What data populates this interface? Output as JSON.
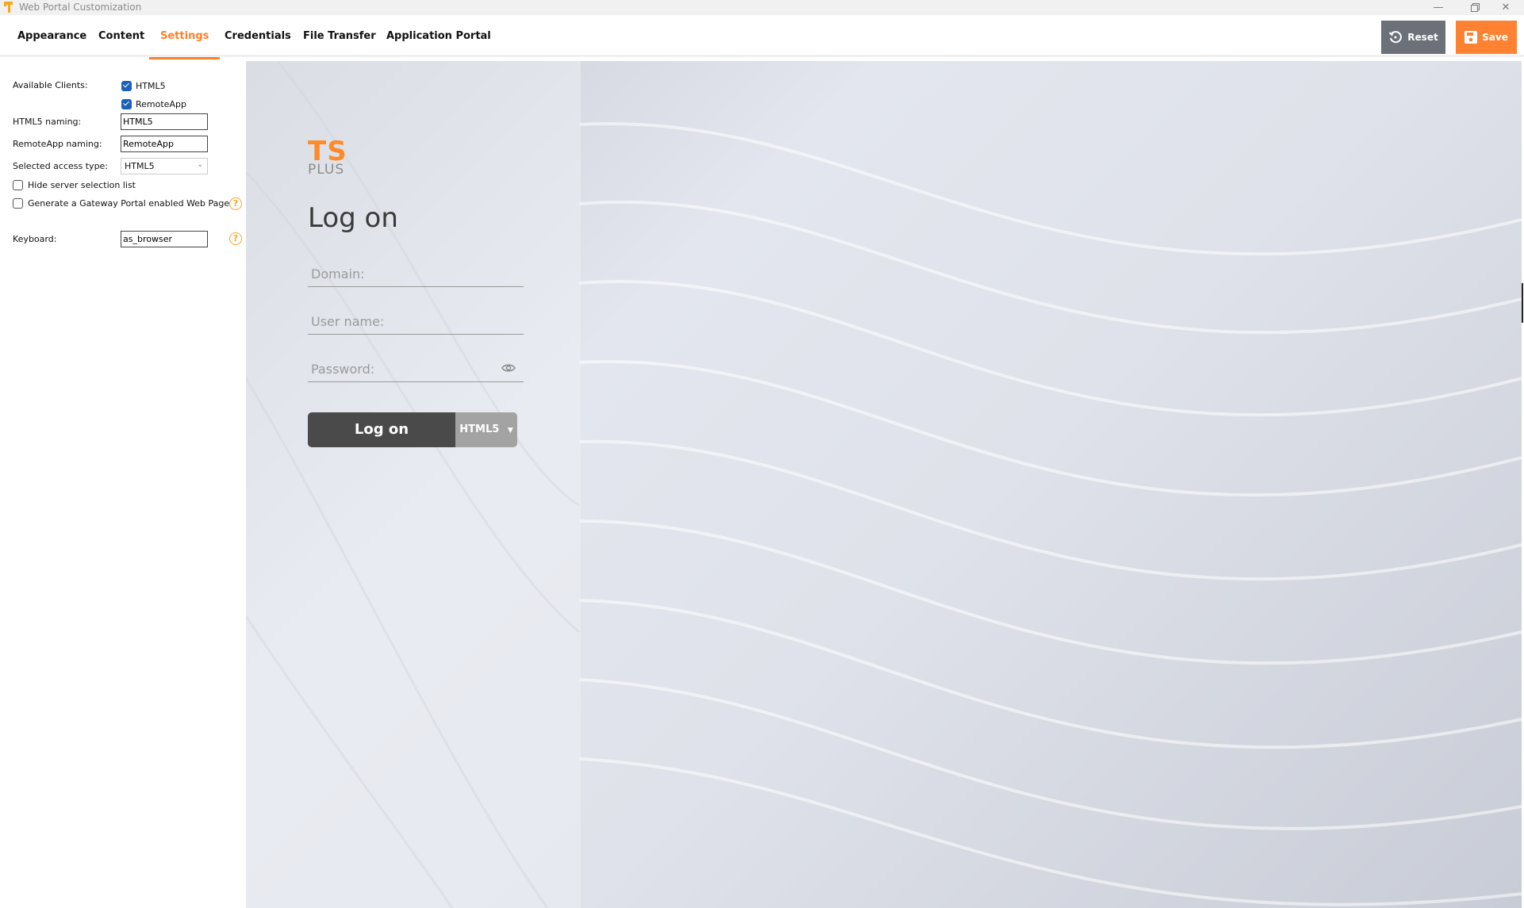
{
  "window": {
    "title": "Web Portal Customization",
    "controls": [
      "minimize",
      "restore",
      "close"
    ]
  },
  "tabs": [
    {
      "label": "Appearance",
      "active": false
    },
    {
      "label": "Content",
      "active": false
    },
    {
      "label": "Settings",
      "active": true
    },
    {
      "label": "Credentials",
      "active": false
    },
    {
      "label": "File Transfer",
      "active": false
    },
    {
      "label": "Application Portal",
      "active": false
    }
  ],
  "toolbar": {
    "reset_label": "Reset",
    "save_label": "Save"
  },
  "colors": {
    "accent": "#ff7f2a",
    "reset_bg": "#6b7079",
    "save_bg": "#ff8233",
    "checkbox": "#1a62b8",
    "help": "#f5a623"
  },
  "settings": {
    "available_clients_label": "Available Clients:",
    "clients": [
      {
        "label": "HTML5",
        "checked": true
      },
      {
        "label": "RemoteApp",
        "checked": true
      }
    ],
    "html5_naming_label": "HTML5 naming:",
    "html5_naming_value": "HTML5",
    "remoteapp_naming_label": "RemoteApp naming:",
    "remoteapp_naming_value": "RemoteApp",
    "access_type_label": "Selected access type:",
    "access_type_value": "HTML5",
    "hide_server_list_label": "Hide server selection list",
    "hide_server_list_checked": false,
    "gateway_portal_label": "Generate a Gateway Portal enabled Web Page",
    "gateway_portal_checked": false,
    "keyboard_label": "Keyboard:",
    "keyboard_value": "as_browser"
  },
  "preview": {
    "logo_top": "TS",
    "logo_bottom": "PLUS",
    "title": "Log on",
    "domain_placeholder": "Domain:",
    "username_placeholder": "User name:",
    "password_placeholder": "Password:",
    "logon_button": "Log on",
    "client_button": "HTML5"
  }
}
